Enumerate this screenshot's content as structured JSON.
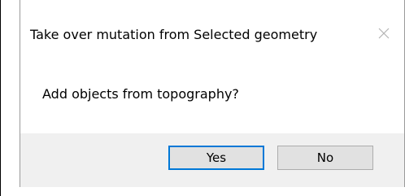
{
  "dialog": {
    "title": "Take over mutation from Selected geometry",
    "message": "Add objects from topography?",
    "buttons": {
      "yes_label": "Yes",
      "no_label": "No"
    },
    "icons": {
      "close": "close-icon"
    },
    "colors": {
      "focus_border": "#0078d7",
      "footer_bg": "#f0f0f0",
      "button_bg": "#e1e1e1",
      "close_icon": "#b4b4b4"
    }
  }
}
